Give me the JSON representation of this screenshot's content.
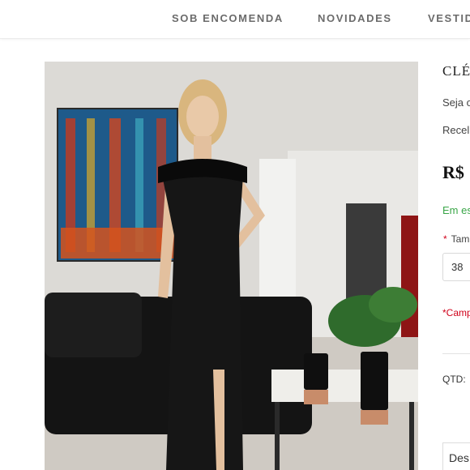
{
  "nav": {
    "items": [
      {
        "label": "SOB ENCOMENDA"
      },
      {
        "label": "NOVIDADES"
      },
      {
        "label": "VESTID"
      }
    ]
  },
  "product": {
    "title": "CLÉ",
    "line1": "Seja o",
    "line2": "Recel",
    "price": "R$",
    "stock": "Em es",
    "size_label": "Tam",
    "size_value": "38",
    "required_note": "*Camp",
    "qty_label": "QTD:",
    "tab_label": "Des"
  },
  "colors": {
    "nav_text": "#6b6b6b",
    "in_stock": "#3aa648",
    "required": "#d0021b"
  }
}
